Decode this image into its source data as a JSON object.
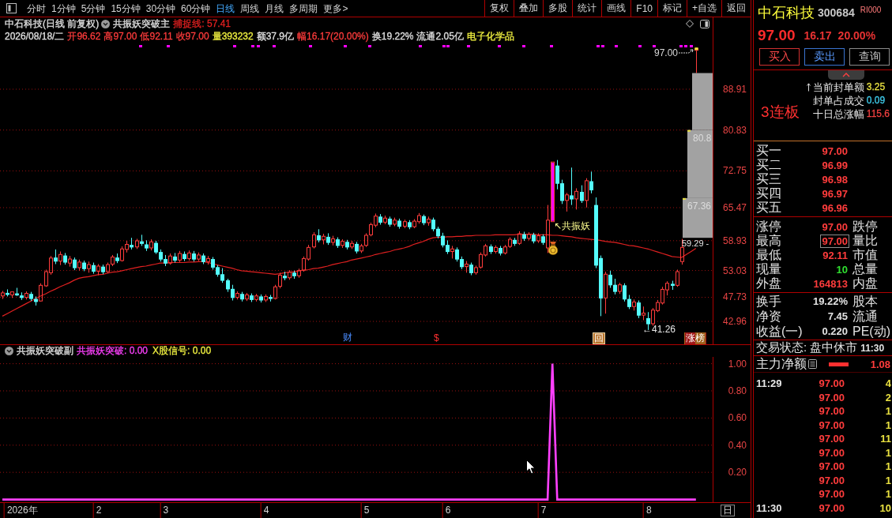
{
  "toolbar": {
    "periods": [
      {
        "label": "分时",
        "selected": false
      },
      {
        "label": "1分钟",
        "selected": false
      },
      {
        "label": "5分钟",
        "selected": false
      },
      {
        "label": "15分钟",
        "selected": false
      },
      {
        "label": "30分钟",
        "selected": false
      },
      {
        "label": "60分钟",
        "selected": false
      },
      {
        "label": "日线",
        "selected": true
      },
      {
        "label": "周线",
        "selected": false
      },
      {
        "label": "月线",
        "selected": false
      },
      {
        "label": "多周期",
        "selected": false
      },
      {
        "label": "更多>",
        "selected": false
      }
    ],
    "actions": [
      "复权",
      "叠加",
      "多股",
      "统计",
      "画线",
      "F10",
      "标记",
      "+自选",
      "返回"
    ]
  },
  "main_pane": {
    "title": "中石科技(日线 前复权)",
    "indicator": "共振妖突破主",
    "series_readouts": [
      ": 57.41"
    ],
    "quote": [
      {
        "text": "2026/08/18/二",
        "color": "#e0e0e0"
      },
      {
        "text": "开96.62",
        "color": "#ff3c3c"
      },
      {
        "text": "高97.00",
        "color": "#ff3c3c"
      },
      {
        "text": "低92.11",
        "color": "#ff3c3c"
      },
      {
        "text": "收97.00",
        "color": "#ff3c3c"
      },
      {
        "text": "量393232",
        "color": "#f0f040"
      },
      {
        "text": "额37.9亿",
        "color": "#e0e0e0"
      },
      {
        "text": "幅16.17(20.00%)",
        "color": "#ff3c3c"
      },
      {
        "text": "换19.22%",
        "color": "#e0e0e0"
      },
      {
        "text": "流通2.05亿",
        "color": "#e0e0e0"
      },
      {
        "text": "电子化学品",
        "color": "#f0f040"
      }
    ],
    "chart_data": {
      "type": "candlestick",
      "grid": true,
      "categories": [
        null,
        null,
        null,
        null,
        null,
        null,
        null,
        null,
        null,
        null,
        null,
        null,
        null,
        null,
        null,
        null,
        null,
        null,
        null,
        null,
        null,
        null,
        null,
        null,
        null,
        null,
        null,
        null,
        null,
        null,
        null,
        null,
        null,
        null,
        null,
        null,
        null,
        null,
        null,
        null,
        null,
        null,
        null,
        null,
        null,
        null,
        null,
        null,
        null,
        null,
        null,
        null,
        null,
        null,
        null,
        null,
        null,
        null,
        null,
        null,
        null,
        null,
        null,
        null,
        null,
        null,
        null,
        null,
        null,
        null,
        null,
        null,
        null,
        null,
        null,
        null,
        null,
        null,
        null,
        null,
        null,
        null,
        null,
        null,
        null,
        null,
        null,
        null,
        null,
        null,
        null,
        null,
        null,
        null,
        null,
        null,
        null,
        null,
        null,
        null,
        null,
        null,
        null,
        null,
        null,
        null,
        null,
        null,
        null,
        null,
        null,
        null,
        null,
        null,
        null,
        null,
        null,
        null,
        null,
        null,
        null,
        null,
        null,
        null,
        null,
        null,
        null,
        null,
        null,
        null,
        null,
        null,
        null,
        null,
        null,
        null,
        null,
        null,
        null,
        null,
        null,
        null,
        null,
        null,
        null,
        null,
        null,
        null,
        null
      ],
      "ohlc": [
        [
          48.0,
          49.0,
          47.4,
          48.6
        ],
        [
          48.6,
          49.3,
          47.9,
          48.2
        ],
        [
          48.2,
          48.9,
          47.6,
          48.8
        ],
        [
          48.5,
          49.6,
          48.0,
          48.1
        ],
        [
          48.1,
          48.7,
          47.2,
          47.6
        ],
        [
          47.7,
          48.9,
          47.3,
          48.5
        ],
        [
          48.4,
          48.8,
          47.0,
          47.4
        ],
        [
          47.4,
          47.9,
          46.1,
          46.8
        ],
        [
          47.0,
          50.5,
          46.9,
          50.1
        ],
        [
          50.0,
          53.2,
          49.8,
          52.8
        ],
        [
          52.6,
          55.9,
          52.2,
          55.5
        ],
        [
          55.6,
          57.2,
          54.3,
          54.8
        ],
        [
          54.9,
          56.8,
          54.1,
          56.2
        ],
        [
          56.0,
          56.5,
          54.2,
          54.6
        ],
        [
          54.5,
          55.9,
          53.8,
          55.3
        ],
        [
          55.2,
          55.6,
          53.1,
          53.5
        ],
        [
          53.6,
          55.2,
          53.0,
          54.7
        ],
        [
          54.6,
          55.0,
          52.9,
          53.3
        ],
        [
          53.4,
          54.8,
          52.6,
          54.2
        ],
        [
          54.1,
          54.6,
          52.4,
          52.8
        ],
        [
          52.9,
          54.3,
          52.1,
          53.9
        ],
        [
          53.8,
          54.2,
          52.3,
          52.7
        ],
        [
          52.8,
          54.6,
          52.5,
          54.2
        ],
        [
          54.3,
          56.1,
          53.9,
          55.7
        ],
        [
          55.6,
          56.4,
          54.5,
          54.9
        ],
        [
          55.0,
          57.8,
          54.8,
          57.3
        ],
        [
          57.2,
          58.9,
          56.6,
          58.2
        ],
        [
          58.1,
          59.5,
          57.2,
          57.6
        ],
        [
          57.7,
          59.3,
          57.3,
          58.9
        ],
        [
          58.8,
          60.1,
          57.9,
          58.3
        ],
        [
          58.2,
          59.0,
          56.9,
          57.4
        ],
        [
          57.5,
          59.2,
          57.0,
          58.7
        ],
        [
          58.5,
          58.9,
          56.3,
          56.6
        ],
        [
          56.7,
          57.2,
          54.8,
          55.2
        ],
        [
          55.3,
          56.1,
          53.9,
          54.4
        ],
        [
          54.5,
          56.4,
          54.2,
          55.9
        ],
        [
          55.8,
          56.5,
          54.6,
          55.0
        ],
        [
          55.1,
          56.9,
          54.7,
          56.4
        ],
        [
          56.3,
          56.8,
          54.9,
          55.3
        ],
        [
          55.4,
          57.0,
          55.0,
          56.5
        ],
        [
          56.4,
          56.9,
          54.8,
          55.2
        ],
        [
          55.3,
          56.6,
          54.9,
          56.1
        ],
        [
          56.0,
          56.4,
          54.3,
          54.7
        ],
        [
          54.8,
          55.9,
          54.2,
          55.4
        ],
        [
          55.3,
          55.7,
          53.2,
          53.6
        ],
        [
          53.7,
          54.1,
          51.8,
          52.2
        ],
        [
          52.3,
          53.5,
          50.6,
          51.0
        ],
        [
          51.1,
          51.4,
          48.8,
          49.3
        ],
        [
          49.4,
          50.2,
          47.1,
          47.6
        ],
        [
          47.7,
          48.9,
          47.3,
          48.5
        ],
        [
          48.4,
          48.8,
          46.9,
          47.3
        ],
        [
          47.4,
          48.6,
          47.0,
          48.2
        ],
        [
          48.1,
          48.5,
          46.8,
          47.2
        ],
        [
          47.3,
          48.4,
          46.9,
          48.0
        ],
        [
          47.9,
          48.3,
          46.7,
          47.1
        ],
        [
          47.2,
          48.3,
          46.8,
          47.9
        ],
        [
          47.8,
          48.2,
          46.9,
          47.4
        ],
        [
          47.5,
          50.2,
          47.3,
          49.8
        ],
        [
          49.9,
          52.6,
          49.5,
          52.1
        ],
        [
          52.0,
          52.8,
          51.1,
          51.5
        ],
        [
          51.6,
          53.1,
          51.2,
          52.7
        ],
        [
          52.6,
          53.0,
          51.4,
          51.9
        ],
        [
          52.0,
          53.4,
          51.6,
          53.0
        ],
        [
          53.1,
          55.8,
          52.8,
          55.4
        ],
        [
          55.3,
          58.1,
          55.0,
          57.6
        ],
        [
          57.7,
          60.6,
          57.4,
          60.1
        ],
        [
          60.0,
          61.2,
          58.6,
          59.0
        ],
        [
          59.1,
          60.3,
          58.2,
          59.8
        ],
        [
          59.7,
          60.4,
          58.1,
          58.5
        ],
        [
          58.6,
          59.9,
          58.0,
          59.3
        ],
        [
          59.2,
          59.6,
          57.5,
          57.9
        ],
        [
          58.0,
          59.2,
          57.5,
          58.8
        ],
        [
          58.7,
          59.1,
          57.2,
          57.6
        ],
        [
          57.7,
          58.9,
          57.3,
          58.4
        ],
        [
          58.3,
          58.7,
          56.4,
          56.8
        ],
        [
          56.9,
          58.3,
          56.5,
          57.9
        ],
        [
          58.0,
          60.4,
          57.7,
          60.0
        ],
        [
          60.1,
          62.5,
          59.8,
          62.1
        ],
        [
          62.0,
          64.3,
          61.6,
          63.8
        ],
        [
          63.7,
          64.2,
          62.1,
          62.5
        ],
        [
          62.6,
          63.9,
          62.2,
          63.4
        ],
        [
          63.3,
          63.7,
          61.7,
          62.1
        ],
        [
          62.2,
          63.5,
          61.8,
          63.0
        ],
        [
          62.9,
          63.3,
          61.3,
          61.7
        ],
        [
          61.8,
          63.1,
          61.4,
          62.7
        ],
        [
          62.6,
          63.0,
          61.2,
          61.6
        ],
        [
          61.7,
          63.2,
          61.4,
          62.8
        ],
        [
          62.7,
          64.4,
          62.3,
          63.9
        ],
        [
          63.8,
          64.1,
          62.0,
          62.4
        ],
        [
          62.5,
          63.7,
          61.9,
          63.2
        ],
        [
          63.1,
          63.5,
          60.8,
          61.2
        ],
        [
          61.3,
          61.7,
          59.4,
          59.8
        ],
        [
          59.9,
          60.5,
          57.6,
          58.0
        ],
        [
          58.1,
          59.0,
          56.3,
          56.7
        ],
        [
          56.8,
          57.9,
          55.4,
          57.3
        ],
        [
          57.2,
          57.6,
          54.8,
          55.2
        ],
        [
          55.3,
          55.8,
          53.3,
          53.7
        ],
        [
          53.8,
          54.9,
          52.6,
          54.3
        ],
        [
          54.2,
          54.6,
          52.1,
          52.5
        ],
        [
          52.6,
          54.0,
          52.2,
          53.6
        ],
        [
          53.7,
          56.6,
          53.4,
          56.2
        ],
        [
          56.1,
          58.3,
          55.8,
          57.9
        ],
        [
          57.8,
          58.2,
          56.3,
          56.7
        ],
        [
          56.8,
          58.0,
          56.4,
          57.6
        ],
        [
          57.5,
          57.9,
          56.0,
          56.4
        ],
        [
          56.5,
          58.1,
          56.2,
          57.7
        ],
        [
          57.8,
          59.6,
          57.5,
          59.2
        ],
        [
          59.1,
          59.5,
          57.9,
          58.3
        ],
        [
          58.4,
          60.8,
          58.1,
          60.3
        ],
        [
          60.2,
          60.7,
          58.9,
          59.3
        ],
        [
          59.4,
          60.6,
          59.0,
          60.2
        ],
        [
          60.1,
          60.5,
          58.4,
          58.8
        ],
        [
          58.9,
          60.4,
          58.5,
          59.9
        ],
        [
          59.8,
          60.2,
          58.1,
          58.5
        ],
        [
          57.5,
          66.0,
          56.5,
          63.0
        ],
        [
          62.7,
          74.5,
          62.7,
          74.5
        ],
        [
          73.8,
          74.9,
          69.1,
          70.2
        ],
        [
          70.3,
          71.0,
          66.2,
          66.8
        ],
        [
          66.9,
          68.4,
          64.7,
          68.0
        ],
        [
          67.9,
          73.4,
          66.0,
          67.1
        ],
        [
          67.2,
          69.3,
          65.1,
          68.7
        ],
        [
          68.6,
          69.9,
          66.4,
          66.8
        ],
        [
          66.9,
          71.3,
          65.5,
          70.8
        ],
        [
          70.7,
          72.6,
          68.3,
          68.9
        ],
        [
          66.0,
          67.5,
          53.5,
          54.0
        ],
        [
          55.5,
          56.0,
          44.0,
          47.5
        ],
        [
          47.6,
          52.8,
          44.5,
          52.3
        ],
        [
          52.2,
          53.0,
          49.6,
          50.1
        ],
        [
          50.2,
          51.4,
          48.3,
          48.8
        ],
        [
          48.9,
          50.6,
          48.4,
          50.2
        ],
        [
          50.1,
          50.5,
          46.9,
          47.3
        ],
        [
          47.4,
          48.2,
          45.4,
          45.8
        ],
        [
          45.9,
          47.3,
          45.1,
          46.8
        ],
        [
          46.7,
          47.1,
          43.6,
          44.1
        ],
        [
          44.2,
          45.9,
          43.2,
          44.6
        ],
        [
          43.6,
          44.8,
          41.26,
          42.4
        ],
        [
          42.5,
          45.6,
          42.1,
          45.2
        ],
        [
          45.1,
          47.2,
          44.8,
          46.7
        ],
        [
          46.6,
          49.8,
          46.3,
          49.3
        ],
        [
          49.2,
          50.9,
          48.1,
          50.5
        ],
        [
          50.4,
          51.0,
          49.2,
          50.0
        ],
        [
          50.1,
          53.2,
          49.8,
          52.8
        ],
        [
          54.8,
          59.29,
          54.2,
          57.6
        ],
        null,
        null,
        [
          96.62,
          97,
          92.11,
          97
        ],
        null,
        null,
        null
      ],
      "series": [
        {
          "name": "捕捉线",
          "type": "line",
          "color": "#e02020",
          "values": [
            44.0,
            44.5,
            45.0,
            45.5,
            46.0,
            46.5,
            47.0,
            47.5,
            48.0,
            48.4,
            48.9,
            49.3,
            49.8,
            50.2,
            50.6,
            51.1,
            51.5,
            51.7,
            51.8,
            52.0,
            52.2,
            52.3,
            52.5,
            52.7,
            52.8,
            53.0,
            53.2,
            53.4,
            53.6,
            53.8,
            53.9,
            54.1,
            54.3,
            54.5,
            54.5,
            54.6,
            54.6,
            54.6,
            54.6,
            54.7,
            54.7,
            54.8,
            54.8,
            54.6,
            54.4,
            54.1,
            53.9,
            53.7,
            53.5,
            53.2,
            53.0,
            52.9,
            52.8,
            52.7,
            52.6,
            52.5,
            52.4,
            52.3,
            52.4,
            52.6,
            52.7,
            52.8,
            53.0,
            53.1,
            53.2,
            53.4,
            53.5,
            53.7,
            53.9,
            54.2,
            54.4,
            54.6,
            54.8,
            55.1,
            55.3,
            55.5,
            55.7,
            55.9,
            56.2,
            56.4,
            56.6,
            56.8,
            57.1,
            57.3,
            57.5,
            57.8,
            58.2,
            58.5,
            58.8,
            59.2,
            59.5,
            59.6,
            59.6,
            59.7,
            59.7,
            59.8,
            59.8,
            59.9,
            59.9,
            60.0,
            60.0,
            60.0,
            60.0,
            60.1,
            60.1,
            60.1,
            60.1,
            60.1,
            60.2,
            60.2,
            60.2,
            60.2,
            60.1,
            60.1,
            60.1,
            60.0,
            60.0,
            59.9,
            59.8,
            59.7,
            59.5,
            59.4,
            59.3,
            59.2,
            59.1,
            59.0,
            58.8,
            58.7,
            58.6,
            58.4,
            58.2,
            58.0,
            57.9,
            57.7,
            57.5,
            57.3,
            57.0,
            56.7,
            56.4,
            56.1,
            55.8,
            55.7,
            55.6,
            56.2,
            56.8,
            57.4,
            null,
            null,
            null
          ]
        }
      ],
      "ylim": [
        38.43,
        98.13
      ],
      "yticks": [
        {
          "value": 88.91,
          "label": "88.91"
        },
        {
          "value": 80.83,
          "label": "80.83"
        },
        {
          "value": 72.75,
          "label": "72.75"
        },
        {
          "value": 65.47,
          "label": "65.47"
        },
        {
          "value": 58.93,
          "label": "58.93"
        },
        {
          "value": 53.03,
          "label": "53.03"
        },
        {
          "value": 47.73,
          "label": "47.73"
        },
        {
          "value": 42.96,
          "label": "42.96"
        }
      ]
    },
    "price_labels": [
      {
        "kind": "high",
        "text": "97.00"
      },
      {
        "kind": "close",
        "text": "59.29 -"
      },
      {
        "kind": "low",
        "text": "←41.26"
      }
    ],
    "block_labels": [
      "80.8",
      "67.36"
    ],
    "signal_label": "↖共振妖",
    "markers": [
      {
        "kind": "finance",
        "text": "财"
      },
      {
        "kind": "dollar",
        "text": "$"
      },
      {
        "kind": "review",
        "text": "回"
      },
      {
        "kind": "rank",
        "text": "涨榜"
      }
    ]
  },
  "sub_pane": {
    "indicator": "共振妖突破副",
    "series_readouts": [
      ": 0.00"
    ],
    "extra_legend": [
      {
        "label": "X股信号",
        "value": ": 0.00",
        "color": "#f0f040"
      }
    ],
    "chart_data": {
      "type": "line",
      "grid": true,
      "categories": [
        null,
        null,
        null,
        null,
        "2026年",
        null,
        null,
        null,
        null,
        null,
        null,
        null,
        null,
        null,
        null,
        null,
        null,
        null,
        null,
        null,
        "2",
        null,
        null,
        null,
        null,
        null,
        null,
        null,
        null,
        null,
        null,
        null,
        null,
        null,
        "3",
        null,
        null,
        null,
        null,
        null,
        null,
        null,
        null,
        null,
        null,
        null,
        null,
        null,
        null,
        null,
        null,
        null,
        null,
        null,
        null,
        "4",
        null,
        null,
        null,
        null,
        null,
        null,
        null,
        null,
        null,
        null,
        null,
        null,
        null,
        null,
        null,
        null,
        null,
        null,
        null,
        null,
        "5",
        null,
        null,
        null,
        null,
        null,
        null,
        null,
        null,
        null,
        null,
        null,
        null,
        null,
        null,
        null,
        null,
        "6",
        null,
        null,
        null,
        null,
        null,
        null,
        null,
        null,
        null,
        null,
        null,
        null,
        null,
        null,
        null,
        null,
        null,
        null,
        null,
        "7",
        null,
        null,
        null,
        null,
        null,
        null,
        null,
        null,
        null,
        null,
        null,
        null,
        null,
        null,
        null,
        null,
        null,
        null,
        null,
        null,
        null,
        "8",
        null,
        null,
        null,
        null,
        null,
        null,
        null,
        null,
        null,
        null,
        null,
        null,
        null
      ],
      "series": [
        {
          "name": "共振妖突破",
          "color": "#ff40ff",
          "values": [
            0,
            0,
            0,
            0,
            0,
            0,
            0,
            0,
            0,
            0,
            0,
            0,
            0,
            0,
            0,
            0,
            0,
            0,
            0,
            0,
            0,
            0,
            0,
            0,
            0,
            0,
            0,
            0,
            0,
            0,
            0,
            0,
            0,
            0,
            0,
            0,
            0,
            0,
            0,
            0,
            0,
            0,
            0,
            0,
            0,
            0,
            0,
            0,
            0,
            0,
            0,
            0,
            0,
            0,
            0,
            0,
            0,
            0,
            0,
            0,
            0,
            0,
            0,
            0,
            0,
            0,
            0,
            0,
            0,
            0,
            0,
            0,
            0,
            0,
            0,
            0,
            0,
            0,
            0,
            0,
            0,
            0,
            0,
            0,
            0,
            0,
            0,
            0,
            0,
            0,
            0,
            0,
            0,
            0,
            0,
            0,
            0,
            0,
            0,
            0,
            0,
            0,
            0,
            0,
            0,
            0,
            0,
            0,
            0,
            0,
            0,
            0,
            0,
            0,
            0,
            1,
            0,
            0,
            0,
            0,
            0,
            0,
            0,
            0,
            0,
            0,
            0,
            0,
            0,
            0,
            0,
            0,
            0,
            0,
            0,
            0,
            0,
            0,
            0,
            0,
            0,
            0,
            0,
            0,
            0,
            0,
            null,
            null,
            null
          ]
        }
      ],
      "ylim": [
        -0.02,
        1.05
      ],
      "yticks": [
        {
          "value": 1,
          "label": "1.00"
        },
        {
          "value": 0.8,
          "label": "0.80"
        },
        {
          "value": 0.6,
          "label": "0.60"
        },
        {
          "value": 0.4,
          "label": "0.40"
        },
        {
          "value": 0.2,
          "label": "0.20"
        }
      ]
    }
  },
  "time_axis": {
    "period_button": "日"
  },
  "quote_panel": {
    "name": "中石科技",
    "code": "300684",
    "tag": "RI000",
    "price": "97.00",
    "change": "16.17",
    "change_pct": "20.00%",
    "trade_buttons": [
      {
        "label": "买入",
        "kind": "buy"
      },
      {
        "label": "卖出",
        "kind": "sell"
      },
      {
        "label": "查询",
        "kind": "query"
      }
    ],
    "streak": "3连板",
    "seal_stats": [
      {
        "label": "当前封单额",
        "value": "3.25",
        "color": "#e8e040"
      },
      {
        "label": "封单占成交",
        "value": "0.09",
        "color": "#40d0f0"
      },
      {
        "label": "十日总涨幅",
        "value": "115.6",
        "color": "#f04040"
      }
    ],
    "bids": [
      {
        "label": "买一",
        "price": "97.00"
      },
      {
        "label": "买二",
        "price": "96.99"
      },
      {
        "label": "买三",
        "price": "96.98"
      },
      {
        "label": "买四",
        "price": "96.97"
      },
      {
        "label": "买五",
        "price": "96.96"
      }
    ],
    "stats": [
      {
        "label": "涨停",
        "value": "97.00",
        "color": "#ff3c3c",
        "highlighted": false,
        "label_2": "跌停"
      },
      {
        "label": "最高",
        "value": "97.00",
        "color": "#ff3c3c",
        "highlighted": true,
        "label_2": "量比"
      },
      {
        "label": "最低",
        "value": "92.11",
        "color": "#ff3c3c",
        "highlighted": false,
        "label_2": "市值"
      },
      {
        "label": "现量",
        "value": "10",
        "color": "#30e030",
        "highlighted": false,
        "label_2": "总量"
      },
      {
        "label": "外盘",
        "value": "164813",
        "color": "#ff3c3c",
        "highlighted": false,
        "label_2": "内盘"
      }
    ],
    "fundamentals": [
      {
        "label": "换手",
        "value": "19.22%",
        "label_2": "股本"
      },
      {
        "label": "净资",
        "value": "7.45",
        "label_2": "流通"
      },
      {
        "label": "收益(一)",
        "value": "0.220",
        "label_2": "PE(动)"
      }
    ],
    "trade_status": {
      "label": "交易状态:",
      "value": "盘中休市",
      "time": "11:30"
    },
    "main_net": {
      "label": "主力净额",
      "value": "1.08"
    },
    "ticks": [
      {
        "time": "11:29",
        "price": "97.00",
        "volume": "4"
      },
      {
        "price": "97.00",
        "volume": "2"
      },
      {
        "price": "97.00",
        "volume": "1"
      },
      {
        "price": "97.00",
        "volume": "1"
      },
      {
        "price": "97.00",
        "volume": "11"
      },
      {
        "price": "97.00",
        "volume": "1"
      },
      {
        "price": "97.00",
        "volume": "1"
      },
      {
        "price": "97.00",
        "volume": "1"
      },
      {
        "price": "97.00",
        "volume": "1"
      },
      {
        "time": "11:30",
        "price": "97.00",
        "volume": "10"
      }
    ]
  }
}
